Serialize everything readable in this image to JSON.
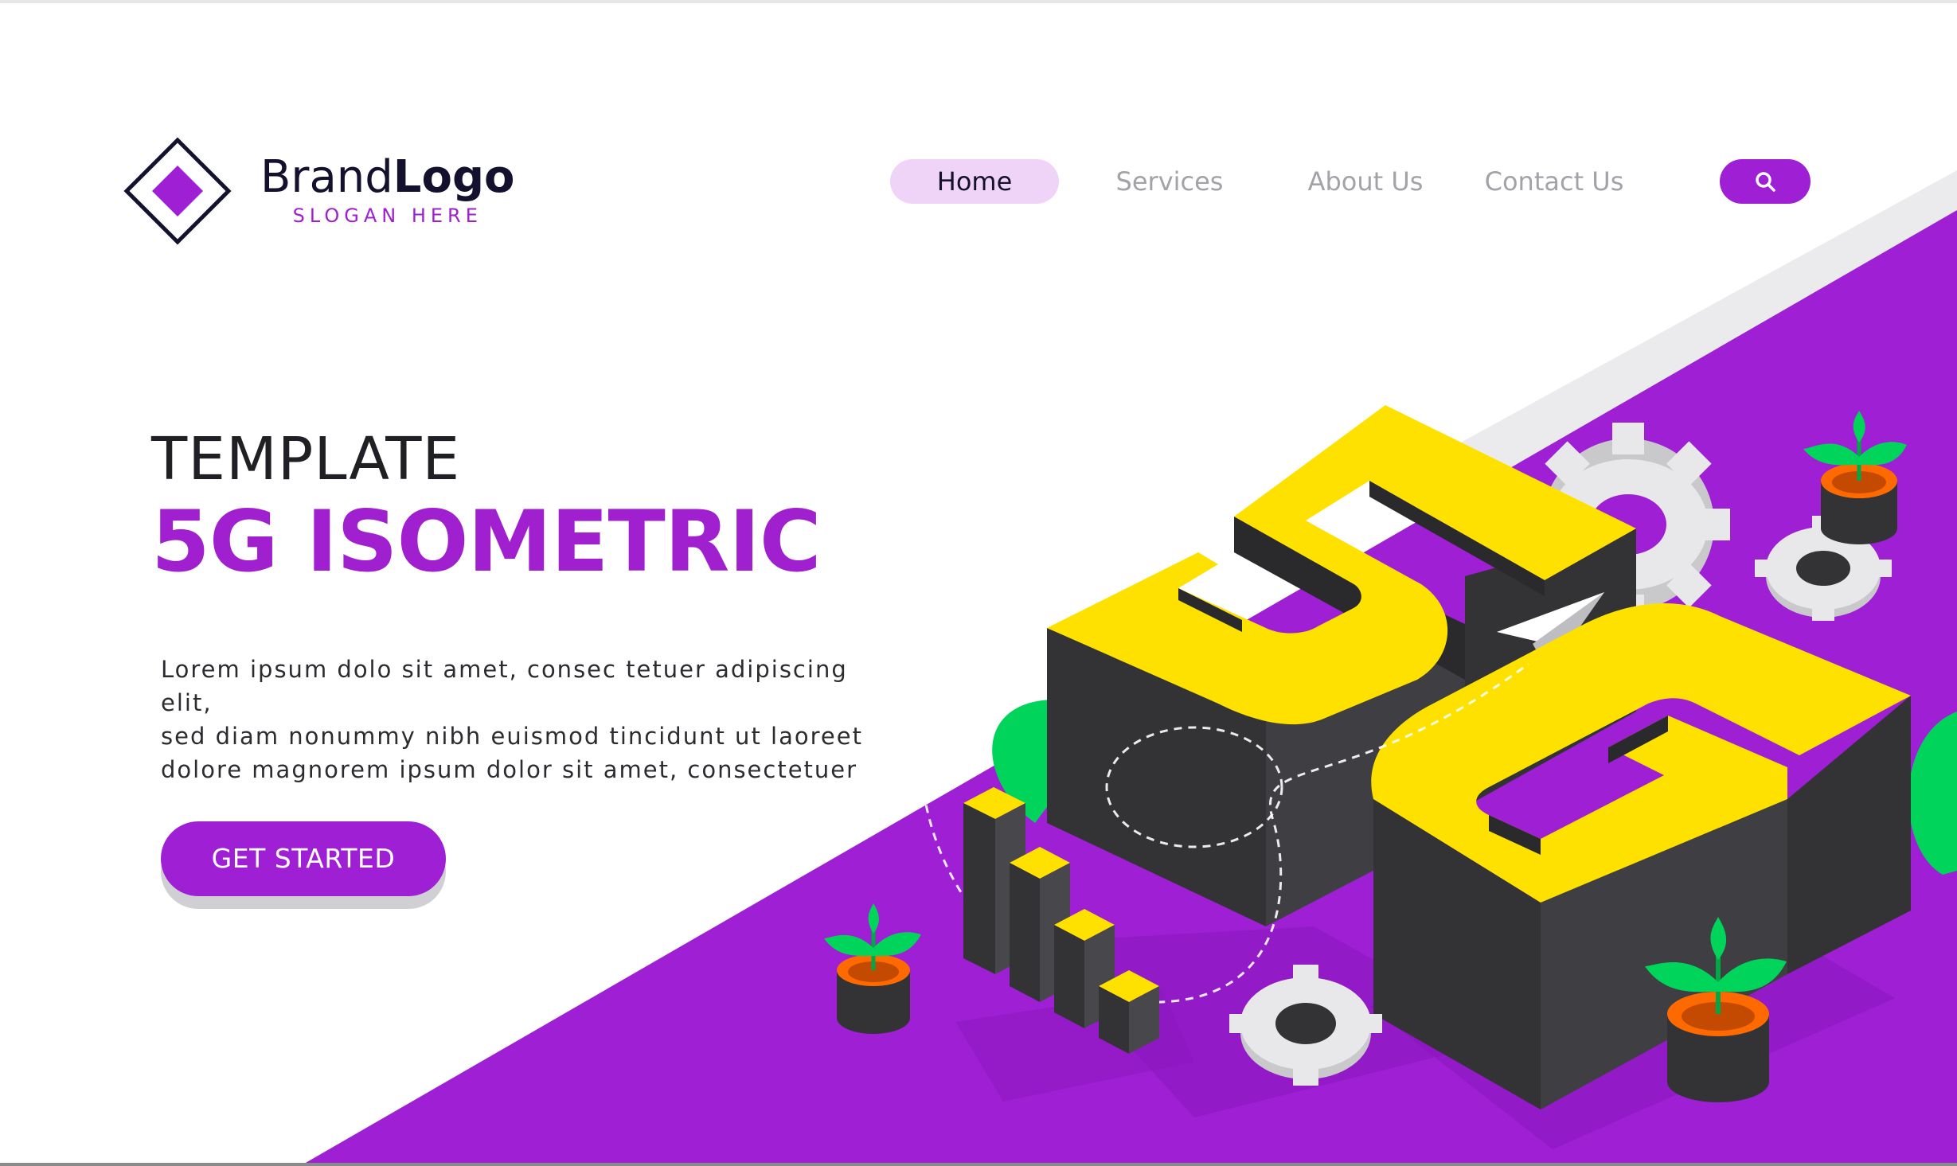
{
  "brand": {
    "name_part1": "Brand",
    "name_part2": "Logo",
    "slogan": "SLOGAN HERE"
  },
  "nav": {
    "items": [
      {
        "label": "Home",
        "active": true
      },
      {
        "label": "Services",
        "active": false
      },
      {
        "label": "About Us",
        "active": false
      },
      {
        "label": "Contact Us",
        "active": false
      }
    ],
    "search_icon": "search-icon"
  },
  "hero": {
    "subtitle": "TEMPLATE",
    "title": "5G ISOMETRIC",
    "body_lines": [
      "Lorem ipsum dolo sit amet, consec tetuer adipiscing elit,",
      "sed diam nonummy nibh euismod tincidunt ut laoreet",
      "dolore magnorem ipsum dolor sit amet, consectetuer"
    ],
    "cta_label": "GET STARTED"
  },
  "illustration": {
    "text": "5G",
    "icons": [
      "gear-icon",
      "plant-pot-icon",
      "paper-plane-icon",
      "bar-blocks-icon",
      "leaf-icon"
    ]
  },
  "colors": {
    "accent": "#9e1fd4",
    "accent_light": "#f0d4f7",
    "yellow": "#ffe100",
    "dark_block": "#333336",
    "green": "#00d45a",
    "orange": "#ff6a00",
    "gear": "#e8e8ea",
    "text_dark": "#14112e",
    "text_muted": "#a2a2a8"
  }
}
